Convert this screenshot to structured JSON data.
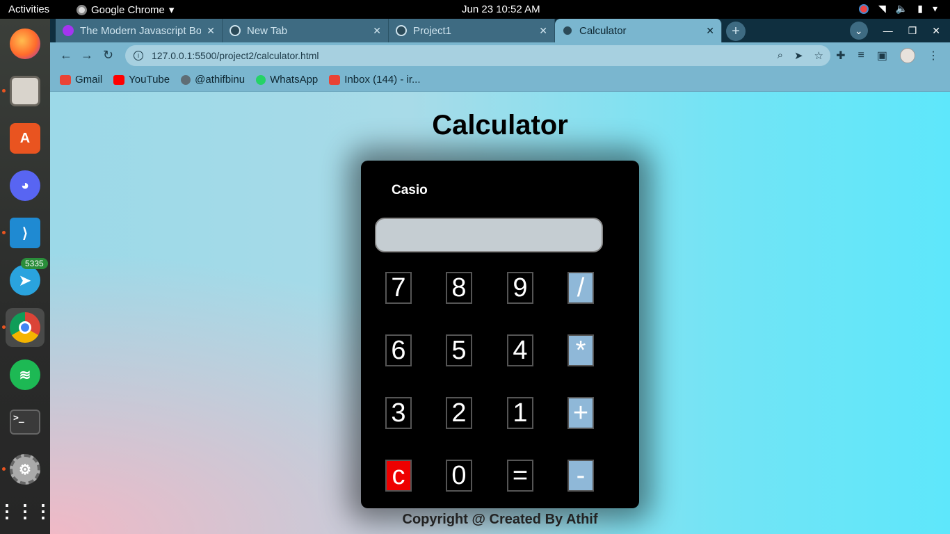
{
  "topbar": {
    "activities": "Activities",
    "app_name": "Google Chrome",
    "clock": "Jun 23  10:52 AM"
  },
  "dock": {
    "telegram_badge": "5335",
    "apps": [
      "firefox-icon",
      "files-icon",
      "app-store-icon",
      "discord-icon",
      "vscode-icon",
      "telegram-icon",
      "chrome-icon",
      "spotify-icon",
      "terminal-icon",
      "settings-icon",
      "app-grid-icon"
    ]
  },
  "tabs": [
    {
      "label": "The Modern Javascript Bootcamp",
      "active": false
    },
    {
      "label": "New Tab",
      "active": false
    },
    {
      "label": "Project1",
      "active": false
    },
    {
      "label": "Calculator",
      "active": true
    }
  ],
  "address": {
    "url": "127.0.0.1:5500/project2/calculator.html"
  },
  "bookmarks": [
    {
      "label": "Gmail",
      "color": "#ea4335"
    },
    {
      "label": "YouTube",
      "color": "#ff0000"
    },
    {
      "label": "@athifbinu",
      "color": "#5f6d75"
    },
    {
      "label": "WhatsApp",
      "color": "#25d366"
    },
    {
      "label": "Inbox (144) - ir...",
      "color": "#ea4335"
    }
  ],
  "page": {
    "title": "Calculator",
    "brand": "Casio",
    "display_value": "",
    "keys": [
      [
        "7",
        "8",
        "9",
        "/"
      ],
      [
        "6",
        "5",
        "4",
        "*"
      ],
      [
        "3",
        "2",
        "1",
        "+"
      ],
      [
        "c",
        "0",
        "=",
        "-"
      ]
    ],
    "footer": "Copyright @ Created By Athif"
  },
  "colors": {
    "operator_key": "#8fb8d8",
    "clear_key": "#ee0000",
    "calc_body": "#000000"
  }
}
